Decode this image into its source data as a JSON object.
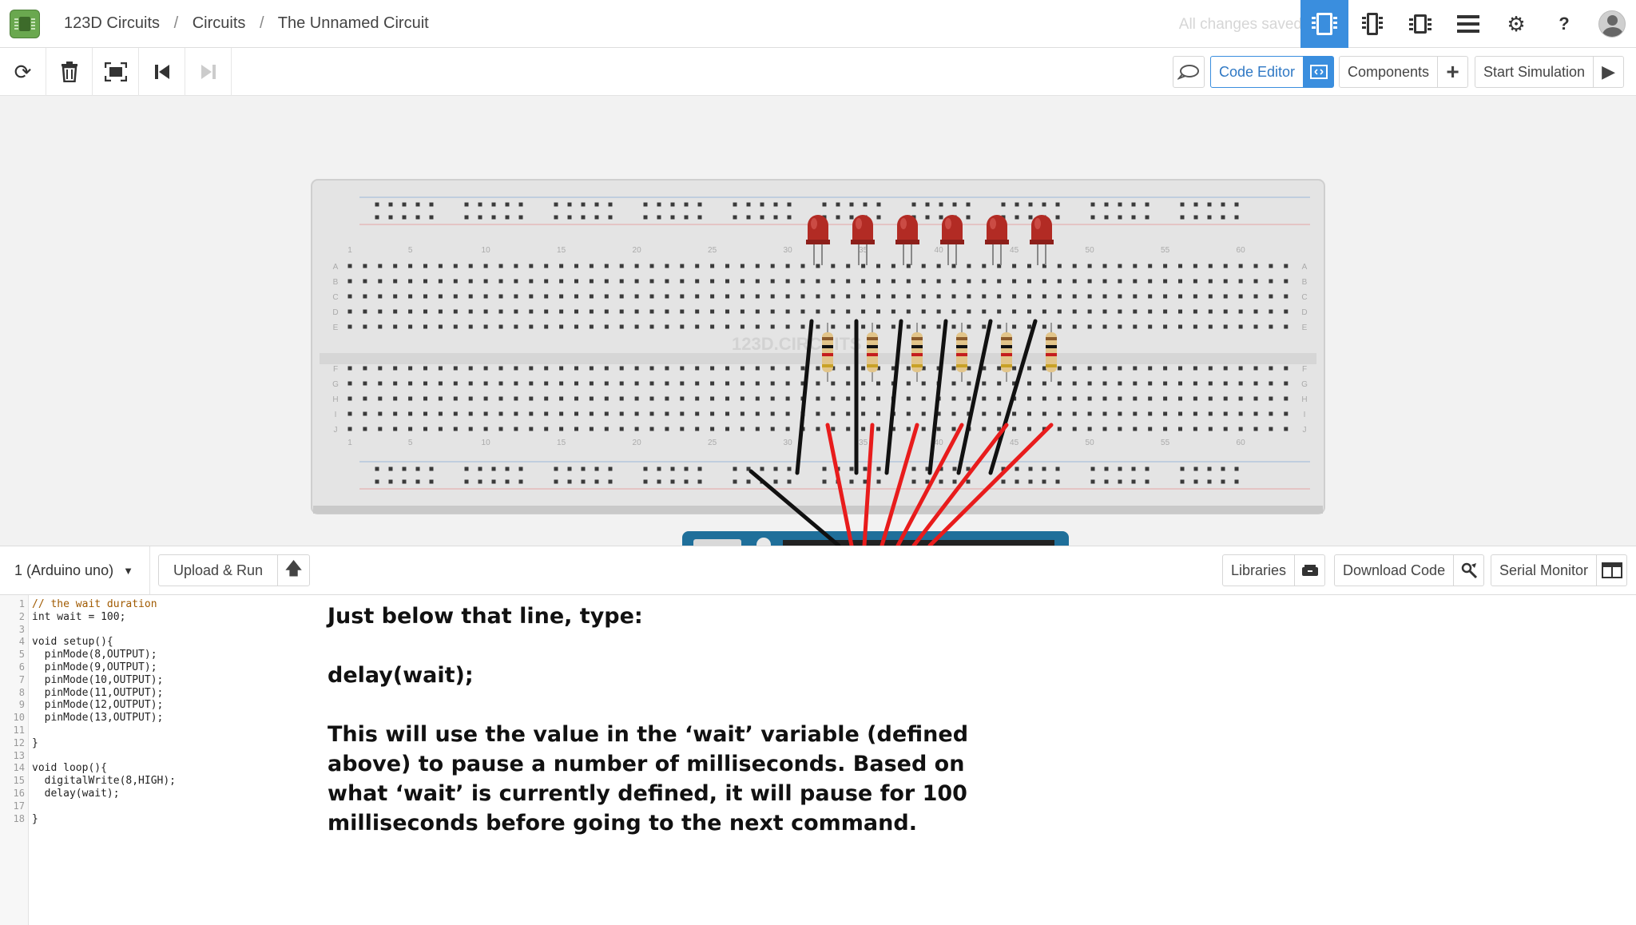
{
  "header": {
    "breadcrumb": [
      "123D Circuits",
      "Circuits",
      "The Unnamed Circuit"
    ],
    "separator": "/",
    "save_status": "All changes saved",
    "help_label": "?"
  },
  "toolbar": {
    "code_editor_label": "Code Editor",
    "components_label": "Components",
    "start_simulation_label": "Start Simulation"
  },
  "circuit": {
    "watermark": "123D.CIRCUITS",
    "column_numbers": [
      "1",
      "5",
      "10",
      "15",
      "20",
      "25",
      "30",
      "35",
      "40",
      "45",
      "50",
      "55",
      "60"
    ],
    "row_letters_top": [
      "A",
      "B",
      "C",
      "D",
      "E"
    ],
    "row_letters_bottom": [
      "F",
      "G",
      "H",
      "I",
      "J"
    ],
    "led_count": 6,
    "resistor_count": 6,
    "colors": {
      "led": "#b22b24",
      "wire_ground": "#111111",
      "wire_signal": "#e81c1c",
      "breadboard": "#e4e4e4",
      "arduino": "#1f6f9a"
    }
  },
  "codebar": {
    "board_select": "1 (Arduino uno)",
    "upload_run_label": "Upload & Run",
    "libraries_label": "Libraries",
    "download_code_label": "Download Code",
    "serial_monitor_label": "Serial Monitor"
  },
  "editor": {
    "line_numbers": [
      "1",
      "2",
      "3",
      "4",
      "5",
      "6",
      "7",
      "8",
      "9",
      "10",
      "11",
      "12",
      "13",
      "14",
      "15",
      "16",
      "17",
      "18"
    ],
    "lines": [
      "// the wait duration",
      "int wait = 100;",
      "",
      "void setup(){",
      "  pinMode(8,OUTPUT);",
      "  pinMode(9,OUTPUT);",
      "  pinMode(10,OUTPUT);",
      "  pinMode(11,OUTPUT);",
      "  pinMode(12,OUTPUT);",
      "  pinMode(13,OUTPUT);",
      "",
      "}",
      "",
      "void loop(){",
      "  digitalWrite(8,HIGH);",
      "  delay(wait);",
      "",
      "}"
    ]
  },
  "instruction": {
    "line1": "Just below that line, type:",
    "line2": "delay(wait);",
    "line3": "This will use the value in the ‘wait’ variable (defined above) to pause a number of milliseconds. Based on what ‘wait’ is currently defined, it will pause for 100 milliseconds before going to the next command."
  }
}
